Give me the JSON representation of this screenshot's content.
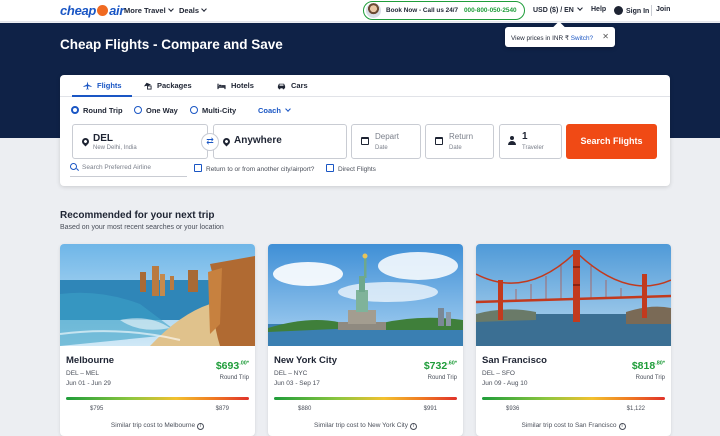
{
  "nav": {
    "logo": {
      "before": "cheap",
      "after": "air"
    },
    "more_travel": "More Travel",
    "deals": "Deals",
    "book_now": "Book Now - Call us 24/7",
    "phone": "000-800-050-2540",
    "currency": "USD ($) / EN",
    "help": "Help",
    "sign_in": "Sign In",
    "join": "Join"
  },
  "tooltip": {
    "text": "View prices in INR ₹",
    "switch": "Switch?",
    "close": "✕"
  },
  "hero": {
    "title": "Cheap Flights - Compare and Save"
  },
  "search": {
    "tabs": [
      {
        "label": "Flights",
        "icon": "plane-icon",
        "active": true
      },
      {
        "label": "Packages",
        "icon": "packages-icon"
      },
      {
        "label": "Hotels",
        "icon": "bed-icon"
      },
      {
        "label": "Cars",
        "icon": "car-icon"
      }
    ],
    "trip_types": [
      "Round Trip",
      "One Way",
      "Multi-City"
    ],
    "selected_trip": "Round Trip",
    "cabin": "Coach",
    "from": {
      "code": "DEL",
      "city": "New Delhi, India"
    },
    "to": {
      "value": "Anywhere"
    },
    "depart": {
      "label": "Depart",
      "sub": "Date"
    },
    "return": {
      "label": "Return",
      "sub": "Date"
    },
    "travelers": {
      "count": "1",
      "label": "Traveler"
    },
    "button": "Search Flights",
    "airline_placeholder": "Search Preferred Airline",
    "return_other": "Return to or from another city/airport?",
    "direct": "Direct Flights"
  },
  "recommended": {
    "title": "Recommended for your next trip",
    "subtitle": "Based on your most recent searches or your location",
    "cards": [
      {
        "city": "Melbourne",
        "route": "DEL – MEL",
        "dates": "Jun 01 - Jun 29",
        "price": "$693",
        "cents": ".00",
        "star": "*",
        "price_type": "Round Trip",
        "low": "$795",
        "high": "$879",
        "similar": "Similar trip cost to Melbourne"
      },
      {
        "city": "New York City",
        "route": "DEL – NYC",
        "dates": "Jun 03 - Sep 17",
        "price": "$732",
        "cents": ".60",
        "star": "*",
        "price_type": "Round Trip",
        "low": "$880",
        "high": "$991",
        "similar": "Similar trip cost to New York City"
      },
      {
        "city": "San Francisco",
        "route": "DEL – SFO",
        "dates": "Jun 09 - Aug 10",
        "price": "$818",
        "cents": ".80",
        "star": "*",
        "price_type": "Round Trip",
        "low": "$936",
        "high": "$1,122",
        "similar": "Similar trip cost to San Francisco"
      }
    ]
  },
  "colors": {
    "navy": "#0f2247",
    "brand_blue": "#1a56c4",
    "accent_orange": "#f04a15",
    "price_green": "#1f9d3a"
  }
}
